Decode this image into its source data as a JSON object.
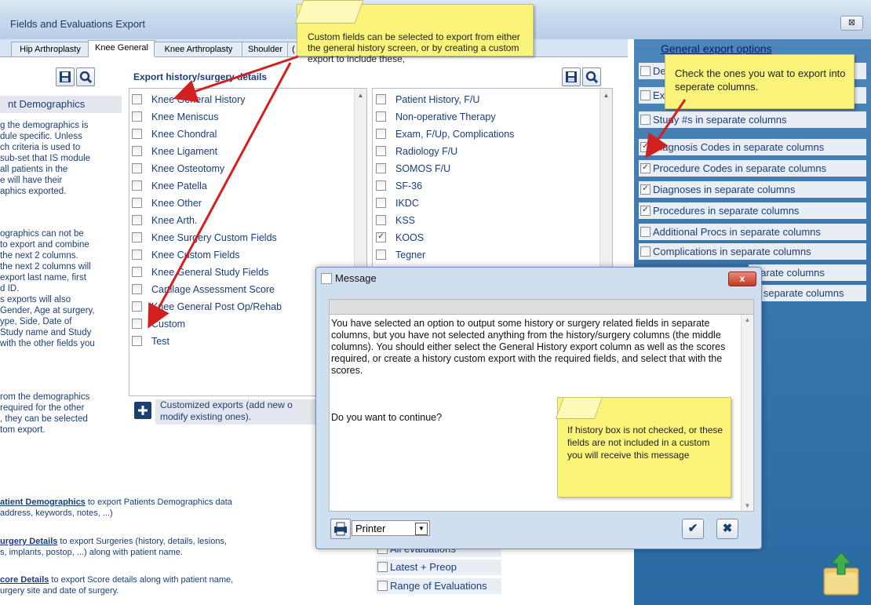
{
  "window": {
    "title": "Fields and Evaluations Export",
    "close_label": "⊠"
  },
  "tabs": [
    {
      "label": "Hip Arthroplasty",
      "active": false
    },
    {
      "label": "Knee General",
      "active": true
    },
    {
      "label": "Knee Arthroplasty",
      "active": false
    },
    {
      "label": "Shoulder",
      "active": false
    },
    {
      "label": "(",
      "active": false
    }
  ],
  "demographics": {
    "title": "nt Demographics",
    "desc1": [
      "g the demographics is",
      "dule specific. Unless",
      "ch criteria is used to",
      "sub-set that IS module",
      "all patients in the",
      "e will have their",
      "aphics exported."
    ],
    "desc2": [
      "ographics can not be",
      "to export and combine",
      "the next 2 columns.",
      "the next 2 columns will",
      "export last name, first",
      "d ID.",
      "s exports will also",
      "Gender, Age at surgery,",
      "ype, Side, Date of",
      "Study name and Study",
      "with the other fields you"
    ],
    "desc3": [
      "rom the demographics",
      "required for the other",
      ", they can be selected",
      "tom export."
    ]
  },
  "history": {
    "title": "Export history/surgery details",
    "items": [
      "Knee General History",
      "Knee Meniscus",
      "Knee Chondral",
      "Knee Ligament",
      "Knee Osteotomy",
      "Knee Patella",
      "Knee Other",
      "Knee Arth.",
      "Knee Surgery Custom Fields",
      "Knee Custom Fields",
      "Knee General Study Fields",
      "Cartilage Assessment Score",
      "Knee General Post Op/Rehab",
      "Custom",
      "Test"
    ],
    "custom_label_1": "Customized exports (add new o",
    "custom_label_2": "modify existing ones)."
  },
  "scores": {
    "items": [
      {
        "label": "Patient History, F/U",
        "checked": false
      },
      {
        "label": "Non-operative Therapy",
        "checked": false
      },
      {
        "label": "Exam, F/Up, Complications",
        "checked": false
      },
      {
        "label": "Radiology F/U",
        "checked": false
      },
      {
        "label": "SOMOS F/U",
        "checked": false
      },
      {
        "label": "SF-36",
        "checked": false
      },
      {
        "label": "IKDC",
        "checked": false
      },
      {
        "label": "KSS",
        "checked": false
      },
      {
        "label": "KOOS",
        "checked": true
      },
      {
        "label": "Tegner",
        "checked": false
      }
    ],
    "eval_all": "All evaluations",
    "eval_latest": "Latest + Preop",
    "eval_range": "Range of Evaluations"
  },
  "links": {
    "l1_bold": "atient Demographics",
    "l1_rest": " to export Patients Demographics data",
    "l1_line2": " address, keywords, notes, ...)",
    "l2_bold": "urgery Details",
    "l2_rest": " to export Surgeries (history, details, lesions,",
    "l2_line2": "s, implants, postop, ...) along with patient name.",
    "l3_bold": "core Details",
    "l3_rest": " to export Score details along with patient name,",
    "l3_line2": "urgery site and date of surgery."
  },
  "general_options": {
    "title": "General export options",
    "items": [
      {
        "label": "De",
        "checked": false
      },
      {
        "label": "Ex",
        "checked": false
      },
      {
        "label": "Study #s in separate columns",
        "checked": false
      },
      {
        "label": "Diagnosis Codes in separate columns",
        "checked": true
      },
      {
        "label": "Procedure Codes in separate columns",
        "checked": true
      },
      {
        "label": "Diagnoses in separate columns",
        "checked": true
      },
      {
        "label": "Procedures in separate columns",
        "checked": true
      },
      {
        "label": "Additional Procs in separate columns",
        "checked": false
      },
      {
        "label": "Complications in separate columns",
        "checked": false
      },
      {
        "label": "parate columns",
        "checked": false
      },
      {
        "label": "h separate columns",
        "checked": false
      }
    ]
  },
  "callouts": {
    "c1": "Custom fields can be selected to export from either the general history screen, or by creating a custom export to include these,",
    "c2": "Check the ones you wat to export into seperate columns.",
    "c3": "If history box is not checked, or these fields are not included in a custom you will receive this message"
  },
  "dialog": {
    "title": "Message",
    "close_label": "x",
    "text": "You have selected an option to output some history or surgery related fields in separate columns, but you have not selected anything from the history/surgery columns (the middle columns).  You should either select the General History export column as well as the scores required, or create a history custom export with the required fields, and select that with the scores.",
    "question": "Do you want to continue?",
    "printer": "Printer",
    "ok": "✔",
    "cancel": "✖"
  },
  "colors": {
    "accent": "#1a3d7a",
    "callout": "#fbf47a",
    "arrow": "#d02020"
  }
}
